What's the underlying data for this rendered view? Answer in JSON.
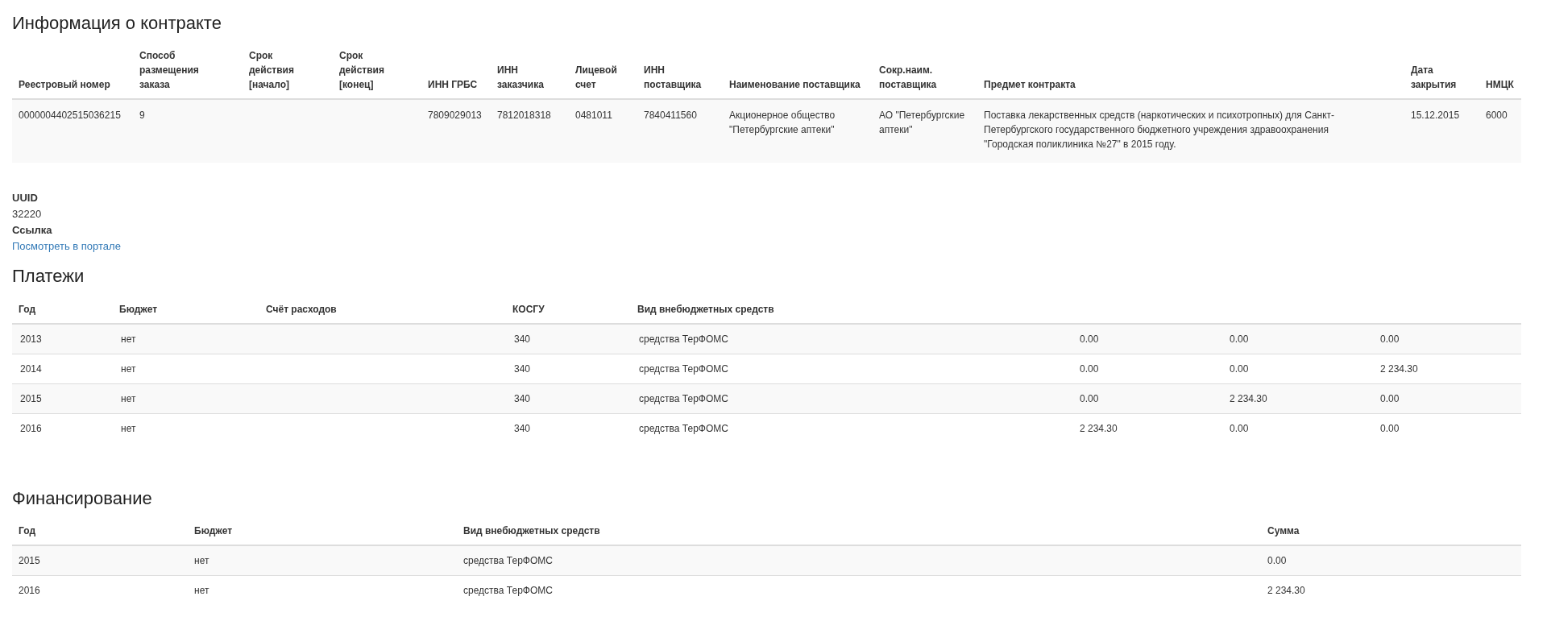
{
  "contract": {
    "title": "Информация о контракте",
    "columns": [
      "Реестровый номер",
      "Способ размещения заказа",
      "Срок действия [начало]",
      "Срок действия [конец]",
      "ИНН ГРБС",
      "ИНН заказчика",
      "Лицевой счет",
      "ИНН поставщика",
      "Наименование поставщика",
      "Сокр.наим. поставщика",
      "Предмет контракта",
      "Дата закрытия",
      "НМЦК"
    ],
    "rows": [
      [
        "0000004402515036215",
        "9",
        null,
        null,
        "7809029013",
        "7812018318",
        "0481011",
        "7840411560",
        "Акционерное общество \"Петербургские аптеки\"",
        "АО \"Петербургские аптеки\"",
        "Поставка лекарственных средств (наркотических и психотропных) для Санкт-Петербургского государственного бюджетного учреждения здравоохранения \"Городская поликлиника №27\" в 2015 году.",
        "15.12.2015",
        "6000"
      ]
    ]
  },
  "details": [
    {
      "label": "UUID",
      "value": "32220",
      "kind": "text"
    },
    {
      "label": "Ссылка",
      "value": "Посмотреть в портале",
      "kind": "link"
    }
  ],
  "payments": {
    "title": "Платежи",
    "columns": [
      "Год",
      "Бюджет",
      "Счёт расходов",
      "КОСГУ",
      "Вид внебюджетных средств",
      null,
      null,
      null
    ],
    "rows": [
      [
        "2013",
        "нет",
        null,
        "340",
        "средства ТерФОМС",
        "0.00",
        "0.00",
        "0.00"
      ],
      [
        "2014",
        "нет",
        null,
        "340",
        "средства ТерФОМС",
        "0.00",
        "0.00",
        "2 234.30"
      ],
      [
        "2015",
        "нет",
        null,
        "340",
        "средства ТерФОМС",
        "0.00",
        "2 234.30",
        "0.00"
      ],
      [
        "2016",
        "нет",
        null,
        "340",
        "средства ТерФОМС",
        "2 234.30",
        "0.00",
        "0.00"
      ]
    ]
  },
  "financing": {
    "title": "Финансирование",
    "columns": [
      "Год",
      "Бюджет",
      "Вид внебюджетных средств",
      "Сумма"
    ],
    "rows": [
      [
        "2015",
        "нет",
        "средства ТерФОМС",
        "0.00"
      ],
      [
        "2016",
        "нет",
        "средства ТерФОМС",
        "2 234.30"
      ]
    ]
  }
}
